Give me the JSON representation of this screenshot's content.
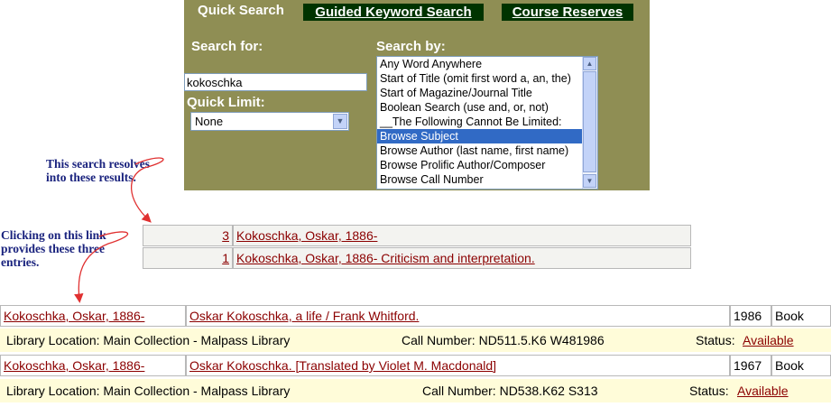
{
  "tabs": {
    "quick_search": "Quick Search",
    "guided_keyword": "Guided Keyword Search",
    "course_reserves": "Course Reserves"
  },
  "search": {
    "search_for_label": "Search for:",
    "value": "kokoschka",
    "quick_limit_label": "Quick Limit:",
    "quick_limit_value": "None",
    "search_by_label": "Search by:",
    "search_by_options": [
      "Any Word Anywhere",
      "Start of Title (omit first word a, an, the)",
      "Start of Magazine/Journal Title",
      "Boolean Search (use and, or, not)",
      "__The Following Cannot Be Limited:",
      "Browse Subject",
      "Browse Author (last name, first name)",
      "Browse Prolific Author/Composer",
      "Browse Call Number"
    ],
    "selected_option": "Browse Subject"
  },
  "annotations": {
    "note1_line1": "This search resolves",
    "note1_line2": "into these results.",
    "note2_line1": "Clicking on this  link",
    "note2_line2": "provides these three",
    "note2_line3": "entries."
  },
  "subject_results": [
    {
      "count": "3",
      "heading": "Kokoschka, Oskar, 1886-"
    },
    {
      "count": "1",
      "heading": "Kokoschka, Oskar, 1886- Criticism and interpretation."
    }
  ],
  "records": [
    {
      "author": "Kokoschka, Oskar, 1886-",
      "title": "Oskar Kokoschka, a life / Frank Whitford.",
      "year": "1986",
      "format": "Book",
      "location": "Library Location: Main Collection - Malpass Library",
      "call_number": "Call Number:  ND511.5.K6 W481986",
      "status_label": "Status:",
      "status": "Available"
    },
    {
      "author": "Kokoschka, Oskar, 1886-",
      "title": "Oskar Kokoschka. [Translated by Violet M. Macdonald]",
      "year": "1967",
      "format": "Book",
      "location": "Library Location: Main Collection - Malpass Library",
      "call_number": "Call Number:  ND538.K62 S313",
      "status_label": "Status:",
      "status": "Available"
    }
  ],
  "colors": {
    "panel": "#8f8e54",
    "tab_dark": "#003300",
    "link": "#8b0000",
    "annotation": "#1a237e",
    "arrow": "#e03030",
    "selected": "#316ac5"
  }
}
